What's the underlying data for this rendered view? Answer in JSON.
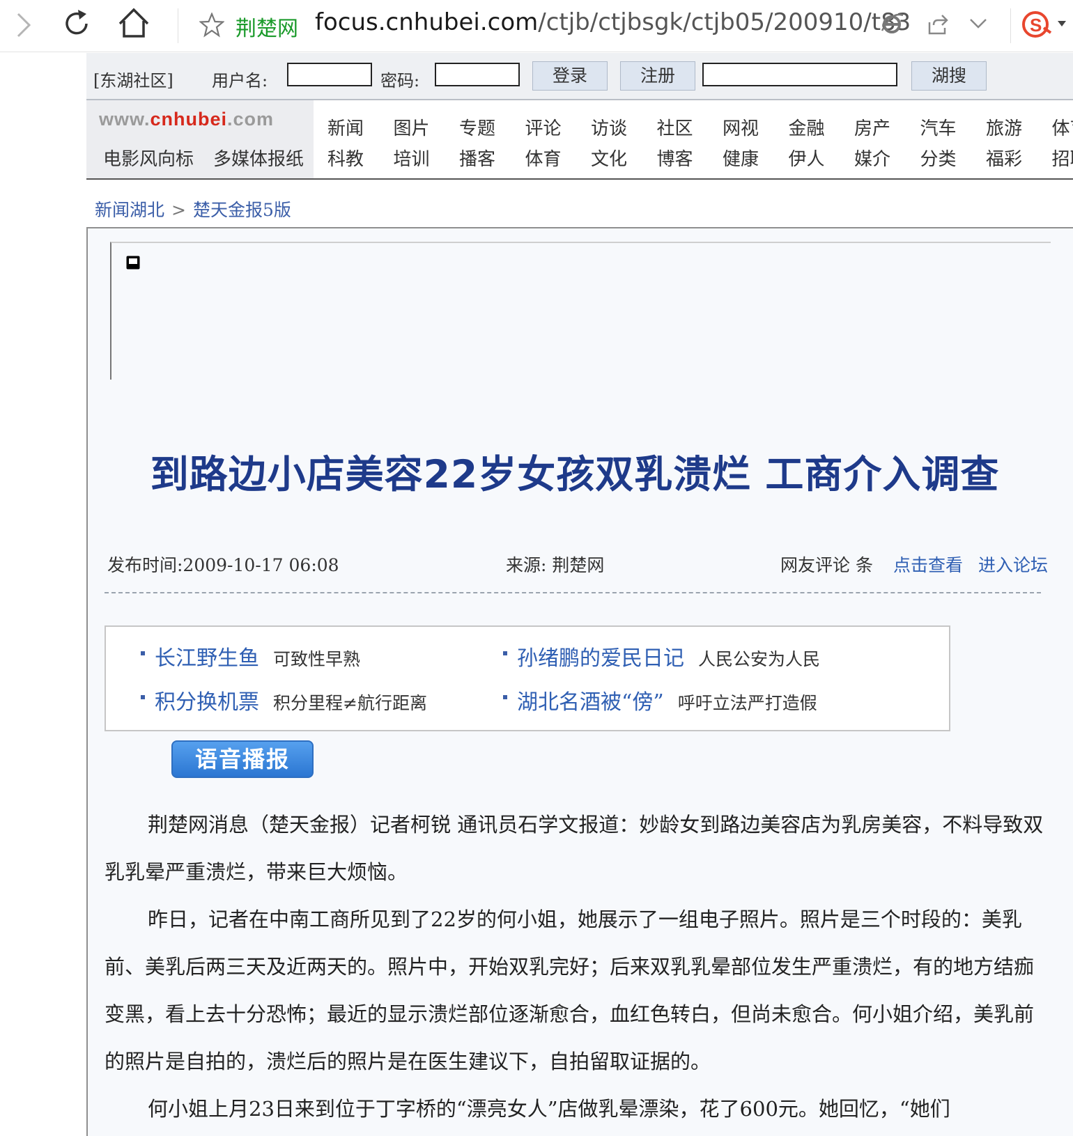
{
  "browser": {
    "site_label": "荆楚网",
    "url_domain": "focus.cnhubei.com",
    "url_path": "/ctjb/ctjbsgk/ctjb05/200910/t83"
  },
  "login_bar": {
    "community": "[东湖社区]",
    "username_label": "用户名:",
    "password_label": "密码:",
    "login_button": "登录",
    "register_button": "注册",
    "search_button": "湖搜"
  },
  "logo": {
    "www": "www.",
    "cnhubei": "cnhubei",
    "com": ".com"
  },
  "sub_links": [
    "电影风向标",
    "多媒体报纸"
  ],
  "nav_row1": [
    "新闻",
    "图片",
    "专题",
    "评论",
    "访谈",
    "社区",
    "网视",
    "金融",
    "房产",
    "汽车",
    "旅游",
    "体育"
  ],
  "nav_row2": [
    "科教",
    "培训",
    "播客",
    "体育",
    "文化",
    "博客",
    "健康",
    "伊人",
    "媒介",
    "分类",
    "福彩",
    "招聘"
  ],
  "breadcrumb": {
    "home": "新闻湖北",
    "separator": ">",
    "current": "楚天金报5版"
  },
  "article": {
    "headline": "到路边小店美容22岁女孩双乳溃烂  工商介入调查",
    "publish_time": "发布时间:2009-10-17 06:08",
    "source": "来源: 荆楚网",
    "comments_label": "网友评论  条",
    "view_link": "点击查看",
    "forum_link": "进入论坛",
    "voice_button": "语音播报",
    "paragraphs": [
      "荆楚网消息（楚天金报）记者柯锐 通讯员石学文报道：妙龄女到路边美容店为乳房美容，不料导致双乳乳晕严重溃烂，带来巨大烦恼。",
      "昨日，记者在中南工商所见到了22岁的何小姐，她展示了一组电子照片。照片是三个时段的：美乳前、美乳后两三天及近两天的。照片中，开始双乳完好；后来双乳乳晕部位发生严重溃烂，有的地方结痂变黑，看上去十分恐怖；最近的显示溃烂部位逐渐愈合，血红色转白，但尚未愈合。何小姐介绍，美乳前的照片是自拍的，溃烂后的照片是在医生建议下，自拍留取证据的。",
      "何小姐上月23日来到位于丁字桥的“漂亮女人”店做乳晕漂染，花了600元。她回忆，“她们"
    ]
  },
  "related": [
    {
      "title": "长江野生鱼",
      "desc": "可致性早熟"
    },
    {
      "title": "孙绪鹏的爱民日记",
      "desc": "人民公安为人民"
    },
    {
      "title": "积分换机票",
      "desc": "积分里程≠航行距离"
    },
    {
      "title": "湖北名酒被“傍”",
      "desc": "呼吁立法严打造假"
    }
  ]
}
